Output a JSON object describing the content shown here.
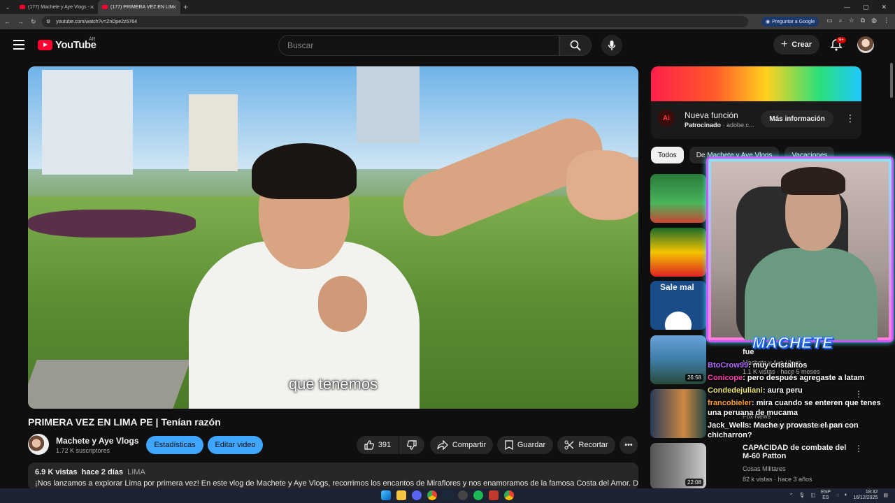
{
  "browser": {
    "tabs": [
      {
        "title": "(177) Machete y Aye Vlogs - Yo"
      },
      {
        "title": "(177) PRIMERA VEZ EN LIMA ..."
      }
    ],
    "new_tab": "+",
    "url": "youtube.com/watch?v=ZnDpe2z5764",
    "ask_google": "Preguntar a Google"
  },
  "youtube": {
    "logo": "YouTube",
    "country": "AR",
    "search_placeholder": "Buscar",
    "create_label": "Crear",
    "notif_badge": "9+"
  },
  "video": {
    "subtitle": "que tenemos",
    "title": "PRIMERA VEZ EN LIMA PE | Tenían razón",
    "channel": "Machete y Aye Vlogs",
    "subscribers": "1.72 K suscriptores",
    "stats_btn": "Estadísticas",
    "edit_btn": "Editar video",
    "likes": "391",
    "share": "Compartir",
    "save": "Guardar",
    "clip": "Recortar",
    "views": "6.9 K vistas",
    "age": "hace 2 días",
    "location": "LIMA",
    "description": "¡Nos lanzamos a explorar Lima por primera vez! En este vlog de Machete y Aye Vlogs, recorrimos los encantos de Miraflores y nos enamoramos de la famosa Costa del Amor. Después"
  },
  "sidebar": {
    "ad": {
      "logo": "Ai",
      "title": "Nueva función",
      "sponsored": "Patrocinado",
      "domain": "adobe.c...",
      "cta": "Más información"
    },
    "chips": [
      "Todos",
      "De Machete y Aye Vlogs",
      "Vacaciones"
    ],
    "videos": [
      {
        "title": "",
        "meta1": "",
        "meta2": "",
        "duration": ""
      },
      {
        "title": "",
        "meta1": "",
        "meta2": "",
        "duration": ""
      },
      {
        "title": "",
        "meta1": "",
        "meta2": "",
        "duration": "",
        "thumb_text": "Sale mal"
      },
      {
        "title": "fue",
        "meta1": "Machete y Aye Vlogs",
        "meta2": "1.1 K vistas · hace 5 meses",
        "duration": "26:58"
      },
      {
        "title": "",
        "meta1": "Fox News",
        "meta2": "4.1 M de vistas · Transmitido hace 4 me...",
        "duration": ""
      },
      {
        "title": "CAPACIDAD de combate del M-60 Patton",
        "meta1": "Cosas Militares",
        "meta2": "82 k vistas · hace 3 años",
        "duration": "22:08"
      }
    ]
  },
  "overlay": {
    "brand": "MACHETE",
    "chat": [
      {
        "user": "BtoCrow99",
        "text": ": muy cristalitos"
      },
      {
        "user": "Conicope",
        "text": ": pero después agregaste a latam"
      },
      {
        "user": "Condedejuliani",
        "text": ": aura peru"
      },
      {
        "user": "francobieler",
        "text": ": mira cuando se enteren que tenes una peruana de mucama"
      },
      {
        "user": "Jack_Wells",
        "text": ": Mache y provaste el pan con chicharron?"
      }
    ]
  },
  "taskbar": {
    "lang1": "ESP",
    "lang2": "ES",
    "time": "18:32",
    "date": "16/12/2025"
  }
}
